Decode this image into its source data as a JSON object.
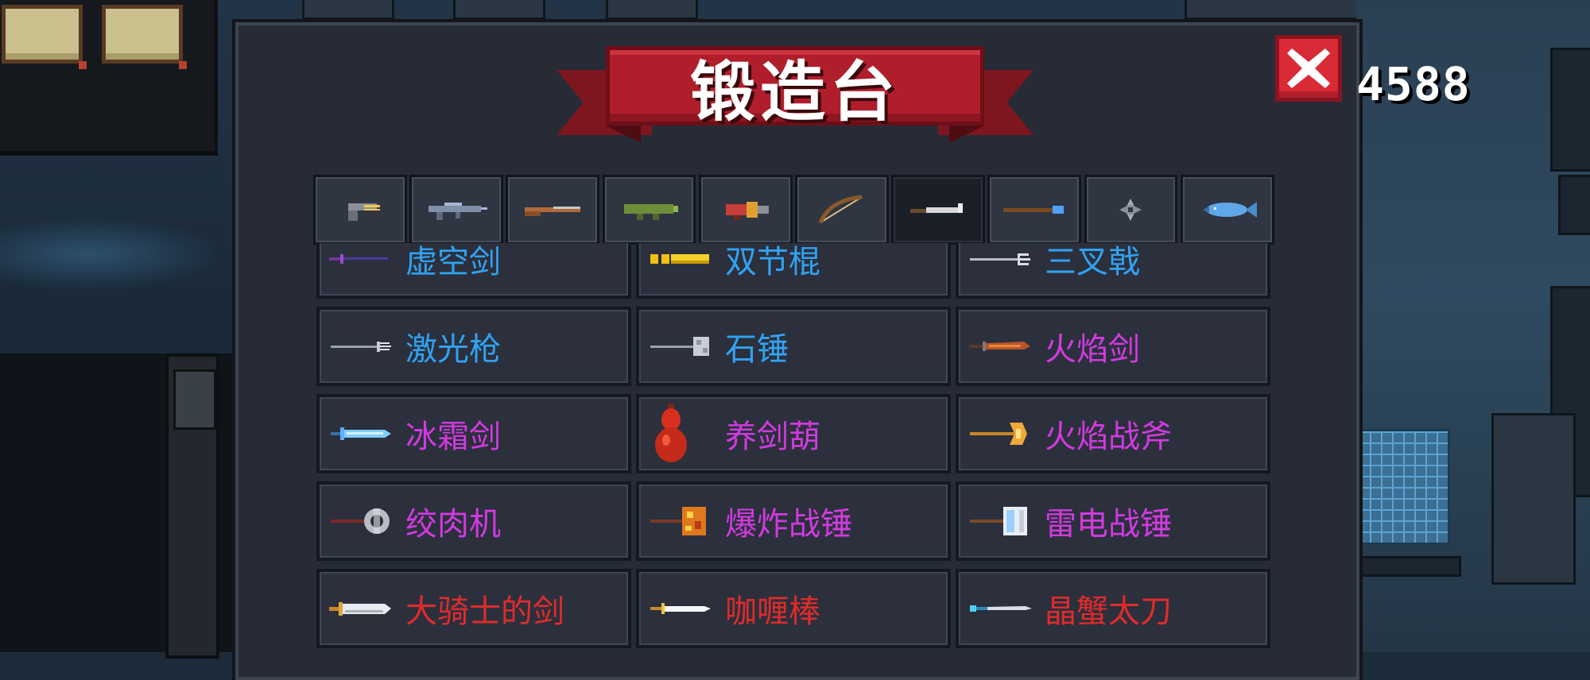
{
  "title": "锻造台",
  "coins": "4588",
  "colors": {
    "common": "#31a2f2",
    "rare": "#d23ae0",
    "epic": "#e02b2b",
    "banner": "#b01e2c"
  },
  "tabs": [
    {
      "icon": "pistol-icon"
    },
    {
      "icon": "rifle-icon"
    },
    {
      "icon": "shotgun-icon"
    },
    {
      "icon": "rocket-launcher-icon"
    },
    {
      "icon": "flame-cannon-icon"
    },
    {
      "icon": "bow-icon"
    },
    {
      "icon": "blade-icon",
      "active": true
    },
    {
      "icon": "staff-icon"
    },
    {
      "icon": "shuriken-icon"
    },
    {
      "icon": "fish-icon"
    }
  ],
  "weapons": [
    {
      "name": "虚空剑",
      "rarity": "common",
      "icon": "void-sword-icon"
    },
    {
      "name": "双节棍",
      "rarity": "common",
      "icon": "nunchaku-icon"
    },
    {
      "name": "三叉戟",
      "rarity": "common",
      "icon": "trident-icon"
    },
    {
      "name": "激光枪",
      "rarity": "common",
      "icon": "laser-spear-icon"
    },
    {
      "name": "石锤",
      "rarity": "common",
      "icon": "stone-hammer-icon"
    },
    {
      "name": "火焰剑",
      "rarity": "rare",
      "icon": "flame-sword-icon"
    },
    {
      "name": "冰霜剑",
      "rarity": "rare",
      "icon": "frost-sword-icon"
    },
    {
      "name": "养剑葫",
      "rarity": "rare",
      "icon": "gourd-icon"
    },
    {
      "name": "火焰战斧",
      "rarity": "rare",
      "icon": "flame-axe-icon"
    },
    {
      "name": "绞肉机",
      "rarity": "rare",
      "icon": "meat-grinder-icon"
    },
    {
      "name": "爆炸战锤",
      "rarity": "rare",
      "icon": "explosive-hammer-icon"
    },
    {
      "name": "雷电战锤",
      "rarity": "rare",
      "icon": "thunder-hammer-icon"
    },
    {
      "name": "大骑士的剑",
      "rarity": "epic",
      "icon": "knight-sword-icon"
    },
    {
      "name": "咖喱棒",
      "rarity": "epic",
      "icon": "excalibur-icon"
    },
    {
      "name": "晶蟹太刀",
      "rarity": "epic",
      "icon": "crab-katana-icon"
    }
  ]
}
